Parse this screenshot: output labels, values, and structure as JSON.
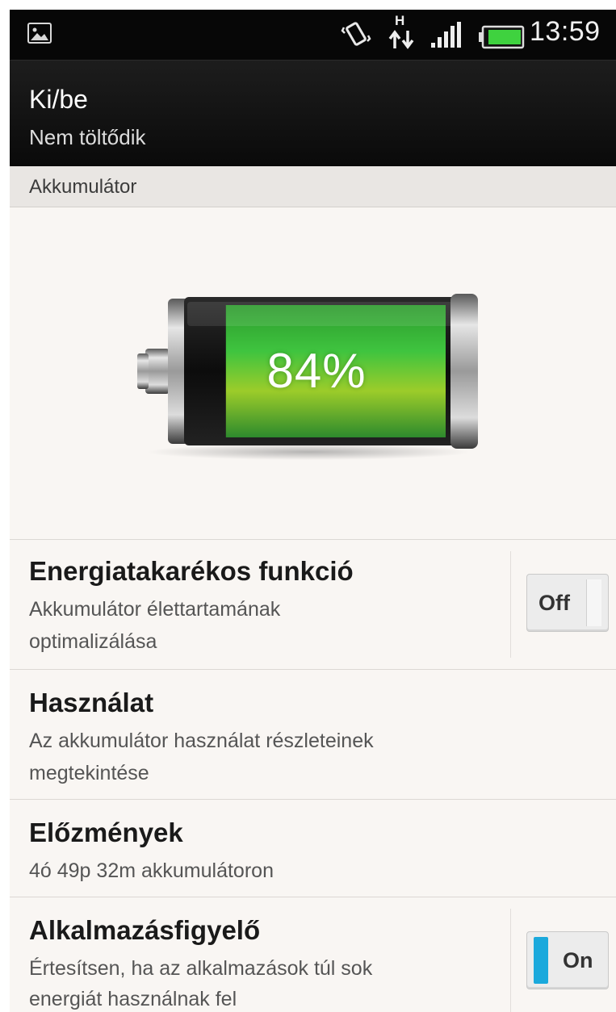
{
  "status_bar": {
    "time": "13:59",
    "network_type": "H"
  },
  "header": {
    "title": "Ki/be",
    "subtitle": "Nem töltődik"
  },
  "section": {
    "label": "Akkumulátor"
  },
  "battery": {
    "percent_label": "84%",
    "level": 0.84
  },
  "settings": [
    {
      "title": "Energiatakarékos funkció",
      "subtitle_line1": "Akkumulátor élettartamának",
      "subtitle_line2": "optimalizálása",
      "toggle": "Off"
    },
    {
      "title": "Használat",
      "subtitle_line1": "Az akkumulátor használat részleteinek",
      "subtitle_line2": "megtekintése"
    },
    {
      "title": "Előzmények",
      "subtitle_line1": "4ó 49p 32m akkumulátoron"
    },
    {
      "title": "Alkalmazásfigyelő",
      "subtitle_line1": "Értesítsen, ha az alkalmazások túl sok",
      "subtitle_line2": "energiát használnak fel",
      "toggle": "On"
    }
  ],
  "colors": {
    "battery_green": "#33c23a",
    "toggle_on_accent": "#1ba9dc",
    "title_bar": "#0a0a0a",
    "background": "#f9f6f3"
  }
}
